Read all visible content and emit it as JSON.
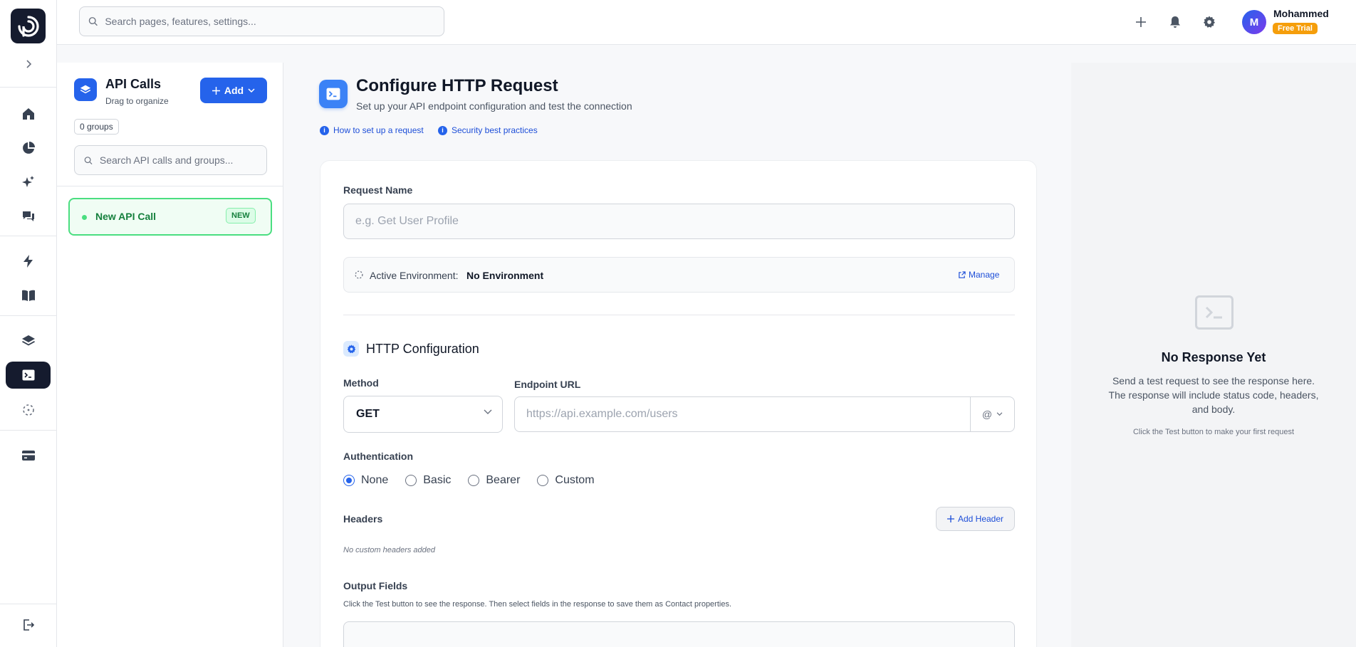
{
  "top": {
    "search_placeholder": "Search pages, features, settings...",
    "user_name": "Mohammed",
    "user_initial": "M",
    "trial_badge": "Free Trial"
  },
  "rail": {
    "icons": [
      "home-icon",
      "pie-chart-icon",
      "sparkles-icon",
      "chat-icon",
      "lightning-icon",
      "book-icon",
      "layers-icon",
      "terminal-icon",
      "loader-icon",
      "credit-card-icon",
      "logout-icon"
    ],
    "active": "terminal-icon"
  },
  "panel": {
    "title": "API Calls",
    "subtitle": "Drag to organize",
    "add_label": "Add",
    "groups_badge": "0 groups",
    "search_placeholder": "Search API calls and groups...",
    "items": [
      {
        "label": "New API Call",
        "badge": "NEW"
      }
    ]
  },
  "main": {
    "title": "Configure HTTP Request",
    "subtitle": "Set up your API endpoint configuration and test the connection",
    "links": [
      "How to set up a request",
      "Security best practices"
    ],
    "request_name_label": "Request Name",
    "request_name_placeholder": "e.g. Get User Profile",
    "env_label": "Active Environment:",
    "env_value": "No Environment",
    "manage_label": "Manage",
    "section_title": "HTTP Configuration",
    "method_label": "Method",
    "method_value": "GET",
    "url_label": "Endpoint URL",
    "url_placeholder": "https://api.example.com/users",
    "var_symbol": "@",
    "auth_label": "Authentication",
    "auth_options": [
      "None",
      "Basic",
      "Bearer",
      "Custom"
    ],
    "auth_selected": "None",
    "headers_label": "Headers",
    "add_header_label": "Add Header",
    "no_headers_text": "No custom headers added",
    "output_label": "Output Fields",
    "output_help": "Click the Test button to see the response. Then select fields in the response to save them as Contact properties."
  },
  "response": {
    "title": "No Response Yet",
    "text": "Send a test request to see the response here. The response will include status code, headers, and body.",
    "hint": "Click the Test button to make your first request"
  },
  "colors": {
    "accent": "#2563eb",
    "dark": "#151b2e",
    "success": "#4ade80",
    "trial": "#f59e0b"
  }
}
